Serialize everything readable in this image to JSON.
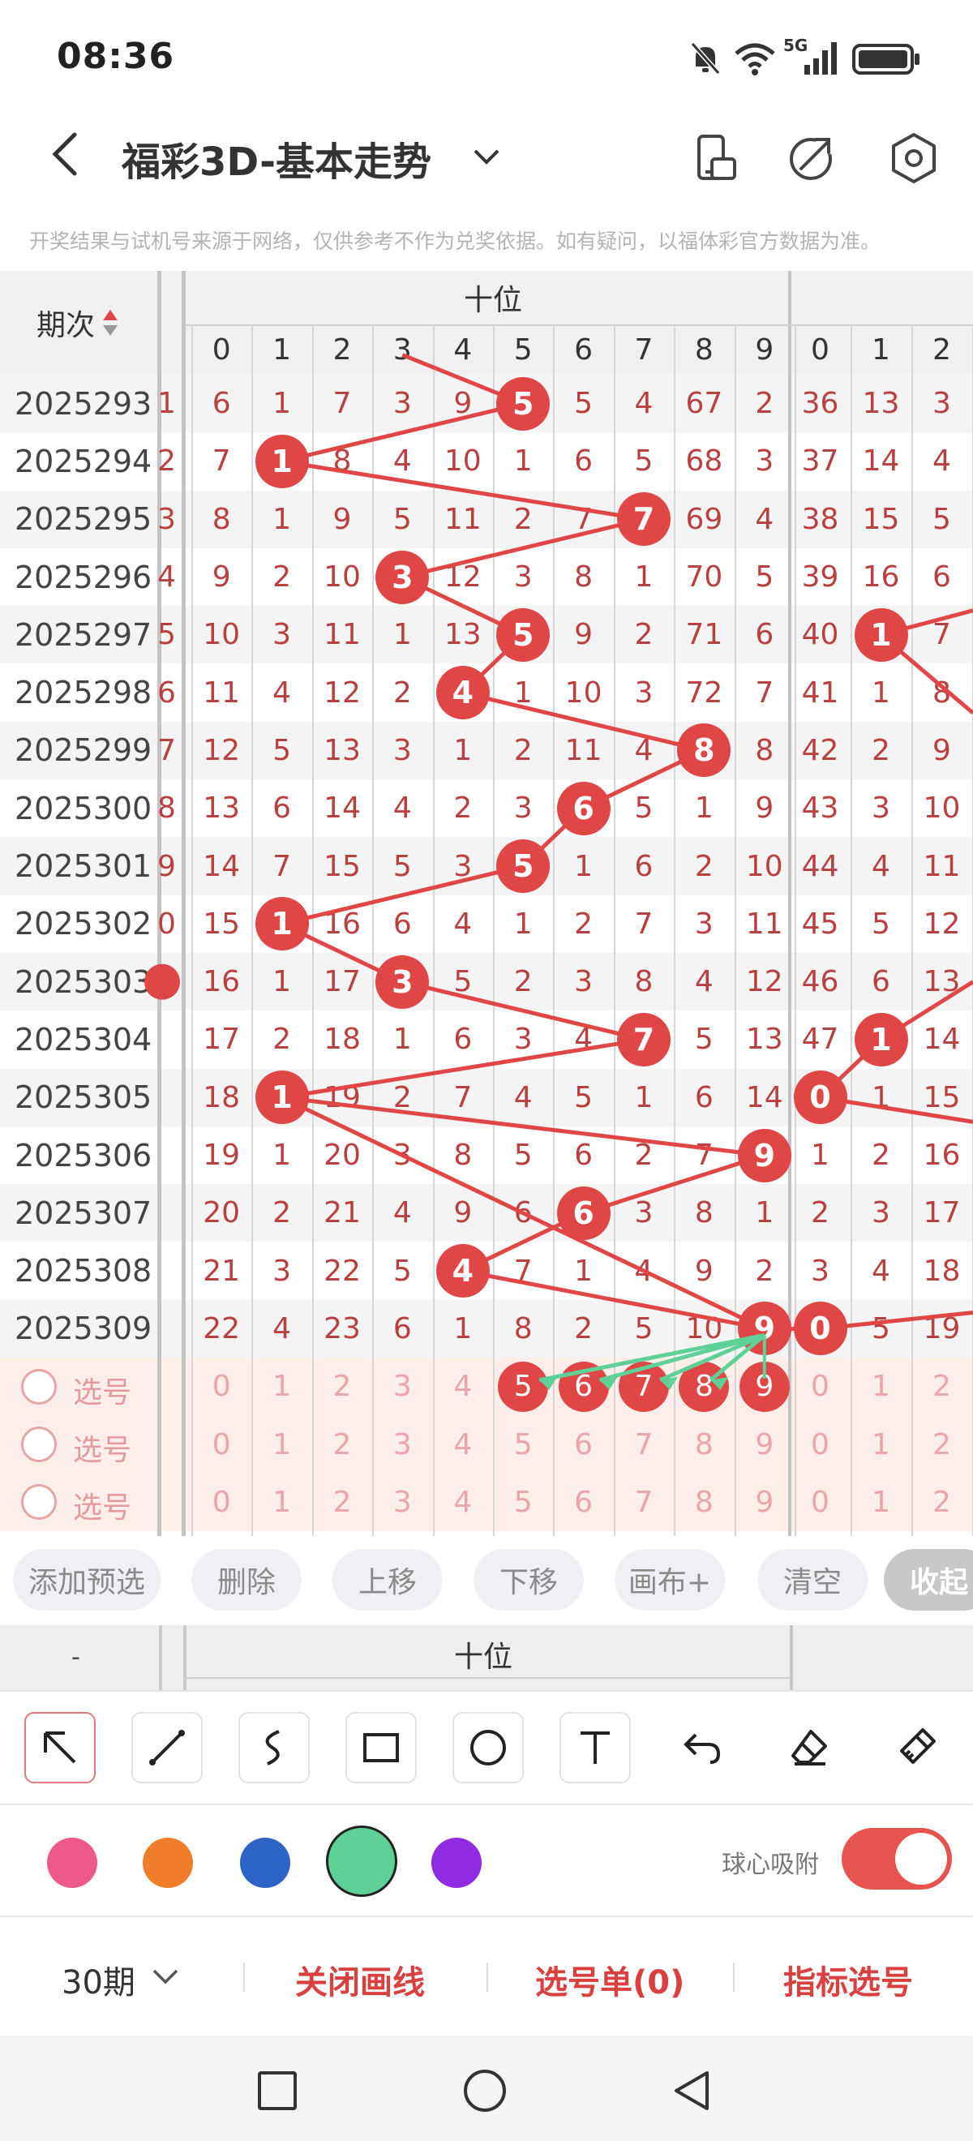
{
  "status_bar": {
    "time": "08:36",
    "network": "5G"
  },
  "nav": {
    "title": "福彩3D-基本走势"
  },
  "notice": "开奖结果与试机号来源于网络，仅供参考不作为兑奖依据。如有疑问，以福体彩官方数据为准。",
  "grid": {
    "issue_header": "期次",
    "group_label": "十位",
    "digit_headers": [
      "0",
      "1",
      "2",
      "3",
      "4",
      "5",
      "6",
      "7",
      "8",
      "9"
    ],
    "right_headers": [
      "0",
      "1",
      "2"
    ],
    "left_edge": [
      "1",
      "2",
      "3",
      "4",
      "5",
      "6",
      "7",
      "8",
      "9",
      "0",
      "",
      "",
      "",
      "",
      "",
      "",
      ""
    ],
    "rows": [
      {
        "issue": "2025293",
        "cells": [
          "6",
          "1",
          "7",
          "3",
          "9",
          "5",
          "5",
          "4",
          "67",
          "2"
        ],
        "right": [
          "36",
          "13",
          "3"
        ]
      },
      {
        "issue": "2025294",
        "cells": [
          "7",
          "1",
          "8",
          "4",
          "10",
          "1",
          "6",
          "5",
          "68",
          "3"
        ],
        "right": [
          "37",
          "14",
          "4"
        ]
      },
      {
        "issue": "2025295",
        "cells": [
          "8",
          "1",
          "9",
          "5",
          "11",
          "2",
          "7",
          "7",
          "69",
          "4"
        ],
        "right": [
          "38",
          "15",
          "5"
        ]
      },
      {
        "issue": "2025296",
        "cells": [
          "9",
          "2",
          "10",
          "3",
          "12",
          "3",
          "8",
          "1",
          "70",
          "5"
        ],
        "right": [
          "39",
          "16",
          "6"
        ]
      },
      {
        "issue": "2025297",
        "cells": [
          "10",
          "3",
          "11",
          "1",
          "13",
          "5",
          "9",
          "2",
          "71",
          "6"
        ],
        "right": [
          "40",
          "1",
          "7"
        ]
      },
      {
        "issue": "2025298",
        "cells": [
          "11",
          "4",
          "12",
          "2",
          "4",
          "1",
          "10",
          "3",
          "72",
          "7"
        ],
        "right": [
          "41",
          "1",
          "8"
        ]
      },
      {
        "issue": "2025299",
        "cells": [
          "12",
          "5",
          "13",
          "3",
          "1",
          "2",
          "11",
          "4",
          "8",
          "8"
        ],
        "right": [
          "42",
          "2",
          "9"
        ]
      },
      {
        "issue": "2025300",
        "cells": [
          "13",
          "6",
          "14",
          "4",
          "2",
          "3",
          "6",
          "5",
          "1",
          "9"
        ],
        "right": [
          "43",
          "3",
          "10"
        ]
      },
      {
        "issue": "2025301",
        "cells": [
          "14",
          "7",
          "15",
          "5",
          "3",
          "5",
          "1",
          "6",
          "2",
          "10"
        ],
        "right": [
          "44",
          "4",
          "11"
        ]
      },
      {
        "issue": "2025302",
        "cells": [
          "15",
          "1",
          "16",
          "6",
          "4",
          "1",
          "2",
          "7",
          "3",
          "11"
        ],
        "right": [
          "45",
          "5",
          "12"
        ]
      },
      {
        "issue": "2025303",
        "cells": [
          "16",
          "1",
          "17",
          "3",
          "5",
          "2",
          "3",
          "8",
          "4",
          "12"
        ],
        "right": [
          "46",
          "6",
          "13"
        ]
      },
      {
        "issue": "2025304",
        "cells": [
          "17",
          "2",
          "18",
          "1",
          "6",
          "3",
          "4",
          "7",
          "5",
          "13"
        ],
        "right": [
          "47",
          "1",
          "14"
        ]
      },
      {
        "issue": "2025305",
        "cells": [
          "18",
          "1",
          "19",
          "2",
          "7",
          "4",
          "5",
          "1",
          "6",
          "14"
        ],
        "right": [
          "0",
          "1",
          "15"
        ]
      },
      {
        "issue": "2025306",
        "cells": [
          "19",
          "1",
          "20",
          "3",
          "8",
          "5",
          "6",
          "2",
          "7",
          "9"
        ],
        "right": [
          "1",
          "2",
          "16"
        ]
      },
      {
        "issue": "2025307",
        "cells": [
          "20",
          "2",
          "21",
          "4",
          "9",
          "6",
          "6",
          "3",
          "8",
          "1"
        ],
        "right": [
          "2",
          "3",
          "17"
        ]
      },
      {
        "issue": "2025308",
        "cells": [
          "21",
          "3",
          "22",
          "5",
          "4",
          "7",
          "1",
          "4",
          "9",
          "2"
        ],
        "right": [
          "3",
          "4",
          "18"
        ]
      },
      {
        "issue": "2025309",
        "cells": [
          "22",
          "4",
          "23",
          "6",
          "1",
          "8",
          "2",
          "5",
          "10",
          "9"
        ],
        "right": [
          "0",
          "5",
          "19"
        ]
      }
    ],
    "hits": [
      5,
      1,
      7,
      3,
      5,
      4,
      8,
      6,
      5,
      1,
      3,
      7,
      1,
      9,
      6,
      4,
      9
    ],
    "right_hits": [
      null,
      null,
      null,
      null,
      1,
      null,
      null,
      null,
      null,
      null,
      null,
      1,
      0,
      null,
      null,
      null,
      0
    ],
    "select_label": "选号",
    "select_digits": [
      "0",
      "1",
      "2",
      "3",
      "4",
      "5",
      "6",
      "7",
      "8",
      "9"
    ],
    "select_right": [
      "0",
      "1",
      "2"
    ],
    "select_balls": [
      "5",
      "6",
      "7",
      "8",
      "9"
    ]
  },
  "actions": [
    "添加预选",
    "删除",
    "上移",
    "下移",
    "画布+",
    "清空",
    "收起"
  ],
  "mini_header": {
    "group_label": "十位",
    "left": "-"
  },
  "tools": [
    "arrow-tool",
    "line-tool",
    "curve-tool",
    "rect-tool",
    "circle-tool",
    "text-tool",
    "undo-tool",
    "eraser-tool",
    "clear-brush-tool"
  ],
  "palette": {
    "colors": [
      "#ec5a8c",
      "#ef7d2b",
      "#2e63c7",
      "#5fd096",
      "#8f2be0"
    ],
    "selected": 3,
    "snap_label": "球心吸附",
    "snap_on": true
  },
  "bottom_bar": {
    "periods": "30期",
    "close_lines": "关闭画线",
    "selection_list": "选号单(0)",
    "indicator_select": "指标选号"
  },
  "annotation": {
    "color": "#4aa944"
  }
}
